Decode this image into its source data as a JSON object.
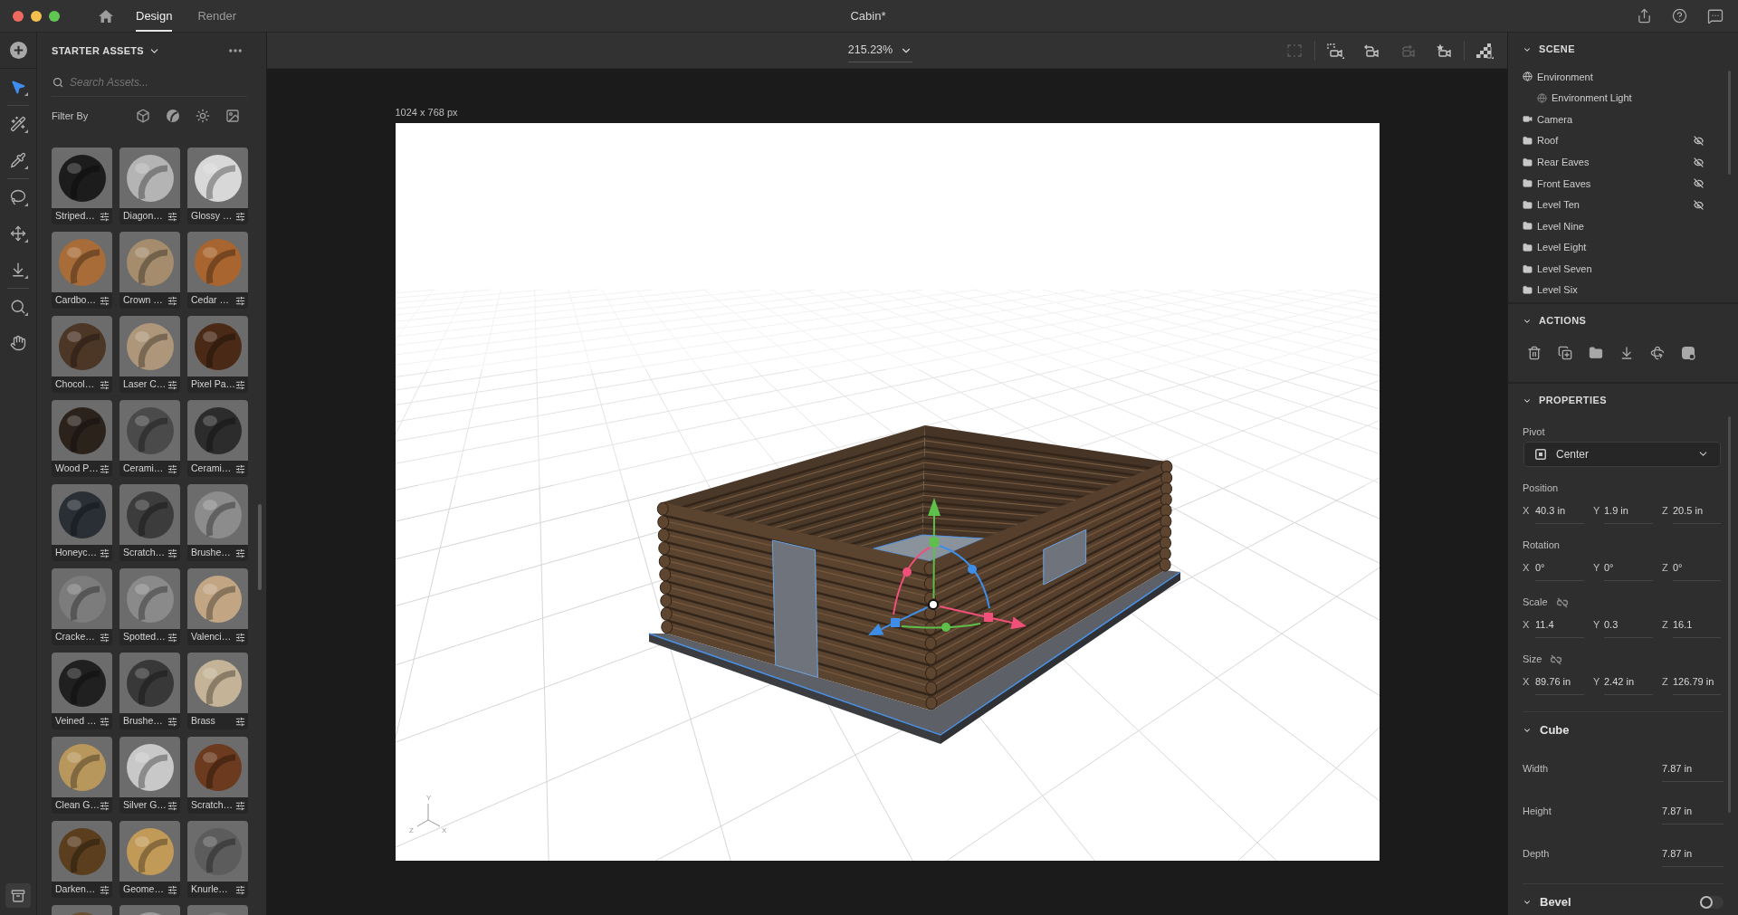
{
  "window": {
    "title": "Cabin*"
  },
  "mode_tabs": [
    {
      "label": "Design",
      "selected": true
    },
    {
      "label": "Render",
      "selected": false
    }
  ],
  "tools": [
    {
      "selected": true,
      "has_menu": true
    },
    {
      "selected": false,
      "has_menu": true
    },
    {
      "selected": false,
      "has_menu": true
    },
    {
      "selected": false,
      "has_menu": true
    },
    {
      "selected": false,
      "has_menu": true
    },
    {
      "selected": false,
      "has_menu": true
    },
    {
      "selected": false,
      "has_menu": true
    },
    {
      "selected": false,
      "has_menu": false
    }
  ],
  "assets_panel": {
    "title": "STARTER ASSETS",
    "search": {
      "placeholder": "Search Assets..."
    },
    "filter_label": "Filter By",
    "assets": [
      {
        "label": "Striped…",
        "color": "#1c1c1c"
      },
      {
        "label": "Diagon…",
        "color": "#b4b4b4"
      },
      {
        "label": "Glossy …",
        "color": "#d8d8d8"
      },
      {
        "label": "Cardbo…",
        "color": "#a86c38"
      },
      {
        "label": "Crown …",
        "color": "#a48c6c"
      },
      {
        "label": "Cedar …",
        "color": "#a8652f"
      },
      {
        "label": "Chocol…",
        "color": "#4c3626"
      },
      {
        "label": "Laser C…",
        "color": "#ad9679"
      },
      {
        "label": "Pixel Pa…",
        "color": "#4a2a16"
      },
      {
        "label": "Wood P…",
        "color": "#2c221c"
      },
      {
        "label": "Cerami…",
        "color": "#4a4a4a"
      },
      {
        "label": "Cerami…",
        "color": "#2c2c2c"
      },
      {
        "label": "Honeyc…",
        "color": "#2a2e35"
      },
      {
        "label": "Scratch…",
        "color": "#3c3c3c"
      },
      {
        "label": "Brushe…",
        "color": "#8c8c8c"
      },
      {
        "label": "Cracke…",
        "color": "#7c7c7c"
      },
      {
        "label": "Spotted…",
        "color": "#8a8a8a"
      },
      {
        "label": "Valenci…",
        "color": "#c2a684"
      },
      {
        "label": "Veined …",
        "color": "#202020"
      },
      {
        "label": "Brushe…",
        "color": "#383838"
      },
      {
        "label": "Brass",
        "color": "#c4b396"
      },
      {
        "label": "Clean G…",
        "color": "#b8975c"
      },
      {
        "label": "Silver G…",
        "color": "#c8c8c8"
      },
      {
        "label": "Scratch…",
        "color": "#6c3a1e"
      },
      {
        "label": "Darken…",
        "color": "#5a3e1e"
      },
      {
        "label": "Geome…",
        "color": "#c29a58"
      },
      {
        "label": "Knurle…",
        "color": "#5c5c5c"
      },
      {
        "color": "#6a5032"
      },
      {
        "color": "#9c9c9c"
      },
      {
        "color": "#7a7a7a"
      }
    ]
  },
  "viewport": {
    "zoom": "215.23%",
    "camera_tools": [
      {
        "disabled": true
      },
      {
        "disabled": false
      },
      {
        "disabled": false
      },
      {
        "disabled": true
      },
      {
        "disabled": false
      }
    ],
    "canvas_size": "1024 x 768 px",
    "axis_labels": [
      "Y",
      "Z",
      "X"
    ]
  },
  "scene": {
    "title": "SCENE",
    "expanded": true,
    "items": [
      {
        "label": "Environment",
        "kind": "environment",
        "hidden": false,
        "children": [
          {
            "label": "Environment Light",
            "kind": "light",
            "hidden": false
          }
        ]
      },
      {
        "label": "Camera",
        "kind": "camera",
        "hidden": false
      },
      {
        "label": "Roof",
        "kind": "folder",
        "hidden": true
      },
      {
        "label": "Rear Eaves",
        "kind": "folder",
        "hidden": true
      },
      {
        "label": "Front Eaves",
        "kind": "folder",
        "hidden": true
      },
      {
        "label": "Level Ten",
        "kind": "folder",
        "hidden": true
      },
      {
        "label": "Level Nine",
        "kind": "folder",
        "hidden": false
      },
      {
        "label": "Level Eight",
        "kind": "folder",
        "hidden": false
      },
      {
        "label": "Level Seven",
        "kind": "folder",
        "hidden": false
      },
      {
        "label": "Level Six",
        "kind": "folder",
        "hidden": false
      }
    ]
  },
  "actions": {
    "title": "ACTIONS",
    "expanded": true
  },
  "properties": {
    "title": "PROPERTIES",
    "expanded": true,
    "pivot": {
      "label": "Pivot",
      "value": "Center"
    },
    "transforms": [
      {
        "label": "Position",
        "fields": [
          {
            "axis": "X",
            "value": "40.3 in"
          },
          {
            "axis": "Y",
            "value": "1.9 in"
          },
          {
            "axis": "Z",
            "value": "20.5 in"
          }
        ]
      },
      {
        "label": "Rotation",
        "fields": [
          {
            "axis": "X",
            "value": "0°"
          },
          {
            "axis": "Y",
            "value": "0°"
          },
          {
            "axis": "Z",
            "value": "0°"
          }
        ]
      },
      {
        "label": "Scale",
        "proportional": false,
        "fields": [
          {
            "axis": "X",
            "value": "11.4"
          },
          {
            "axis": "Y",
            "value": "0.3"
          },
          {
            "axis": "Z",
            "value": "16.1"
          }
        ]
      },
      {
        "label": "Size",
        "proportional": false,
        "fields": [
          {
            "axis": "X",
            "value": "89.76 in"
          },
          {
            "axis": "Y",
            "value": "2.42 in"
          },
          {
            "axis": "Z",
            "value": "126.79 in"
          }
        ]
      }
    ]
  },
  "cube": {
    "title": "Cube",
    "expanded": true,
    "fields": [
      {
        "label": "Width",
        "value": "7.87 in"
      },
      {
        "label": "Height",
        "value": "7.87 in"
      },
      {
        "label": "Depth",
        "value": "7.87 in"
      }
    ]
  },
  "bevel": {
    "title": "Bevel",
    "expanded": true,
    "on": false
  }
}
